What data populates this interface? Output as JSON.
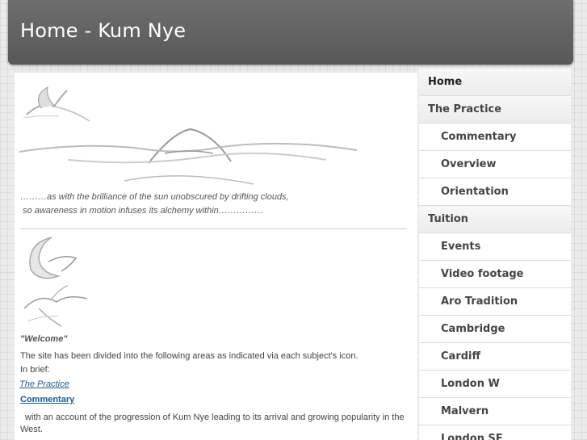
{
  "header": {
    "title": "Home - Kum Nye"
  },
  "nav": [
    {
      "label": "Home",
      "level": "top",
      "active": true
    },
    {
      "label": "The Practice",
      "level": "top"
    },
    {
      "label": "Commentary",
      "level": "sub"
    },
    {
      "label": "Overview",
      "level": "sub"
    },
    {
      "label": "Orientation",
      "level": "sub"
    },
    {
      "label": "Tuition",
      "level": "top"
    },
    {
      "label": "Events",
      "level": "sub"
    },
    {
      "label": "Video footage",
      "level": "sub"
    },
    {
      "label": "Aro Tradition",
      "level": "sub"
    },
    {
      "label": "Cambridge",
      "level": "sub"
    },
    {
      "label": "Cardiff",
      "level": "sub"
    },
    {
      "label": "London W",
      "level": "sub"
    },
    {
      "label": "Malvern",
      "level": "sub"
    },
    {
      "label": "London SE",
      "level": "sub"
    }
  ],
  "main": {
    "caption_line1": "………as with the brilliance of the sun unobscured by drifting clouds,",
    "caption_line2": "so awareness in motion infuses its alchemy within……………",
    "welcome": "\"Welcome\"",
    "intro": "The site has been divided into the following areas as indicated via each subject's icon.",
    "in_brief": "In brief:",
    "practice_link": "The Practice",
    "commentary_link": "Commentary",
    "commentary_desc": "with an account of the progression of Kum Nye leading to its arrival and growing popularity in the West."
  },
  "colors": {
    "header_bg": "#5f5f5f",
    "link": "#1e5b8f",
    "page_bg": "#ebebeb"
  },
  "icons": [
    "crane-sketch-icon",
    "sun-clouds-sketch-icon",
    "moon-crane-sketch-icon",
    "two-cranes-sketch-icon"
  ]
}
